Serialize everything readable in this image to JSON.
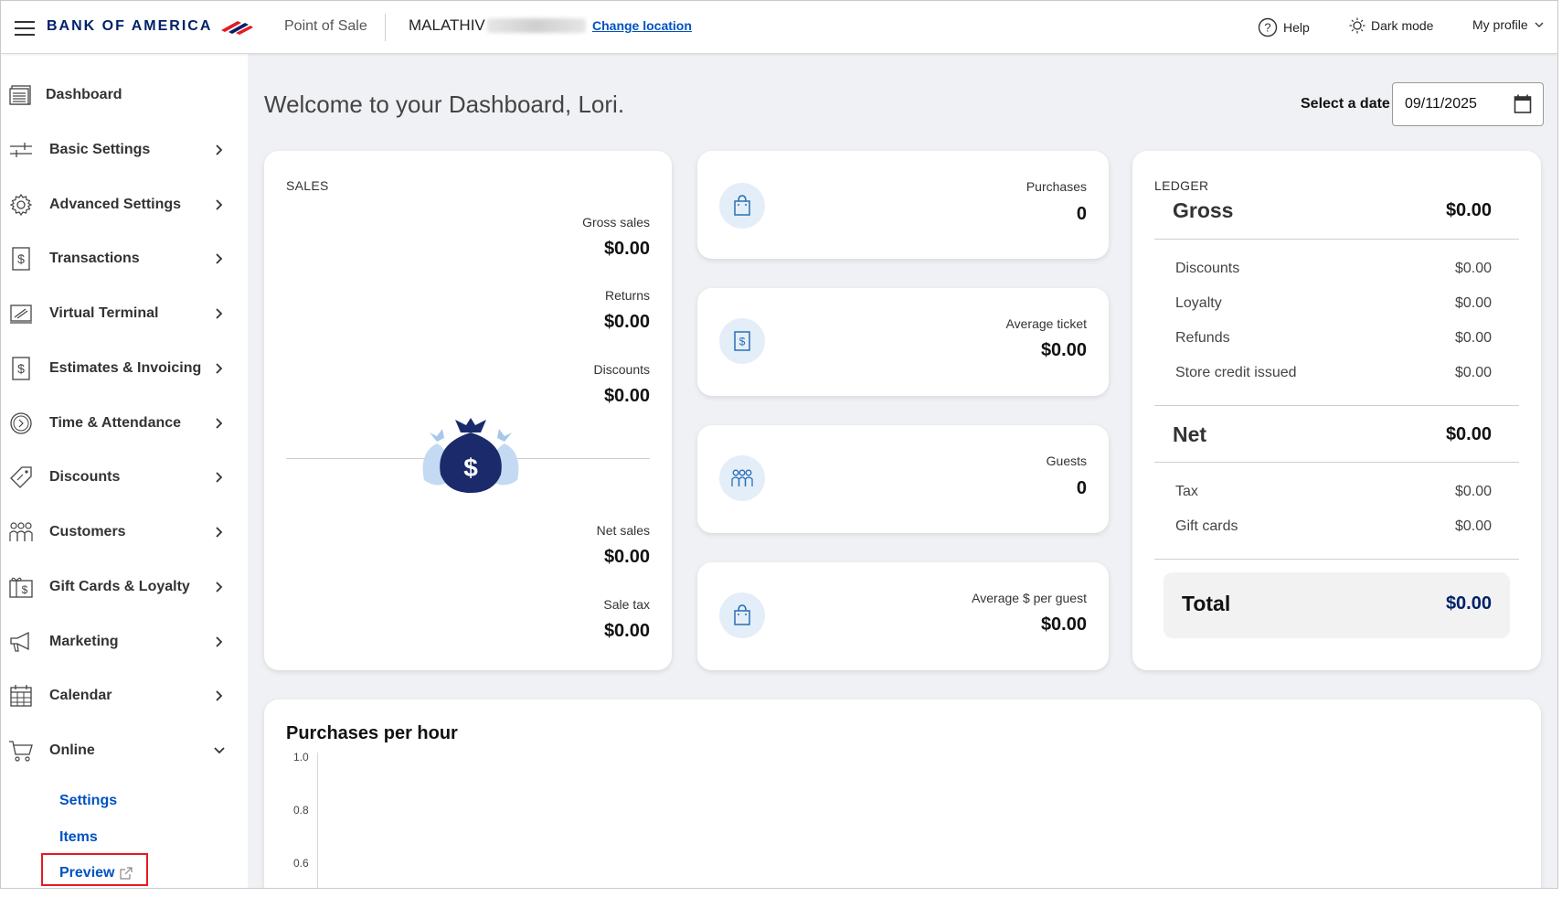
{
  "header": {
    "logo_text": "BANK OF AMERICA",
    "product": "Point of Sale",
    "merchant_name": "MALATHIV",
    "change_location": "Change location",
    "help": "Help",
    "dark_mode": "Dark mode",
    "my_profile": "My profile"
  },
  "sidebar": {
    "items": [
      {
        "label": "Dashboard",
        "icon": "dashboard-icon"
      },
      {
        "label": "Basic Settings",
        "icon": "sliders-icon"
      },
      {
        "label": "Advanced Settings",
        "icon": "gear-icon"
      },
      {
        "label": "Transactions",
        "icon": "dollar-document-icon"
      },
      {
        "label": "Virtual Terminal",
        "icon": "terminal-icon"
      },
      {
        "label": "Estimates & Invoicing",
        "icon": "invoice-icon"
      },
      {
        "label": "Time & Attendance",
        "icon": "clock-icon"
      },
      {
        "label": "Discounts",
        "icon": "tag-icon"
      },
      {
        "label": "Customers",
        "icon": "people-icon"
      },
      {
        "label": "Gift Cards & Loyalty",
        "icon": "gift-card-icon"
      },
      {
        "label": "Marketing",
        "icon": "megaphone-icon"
      },
      {
        "label": "Calendar",
        "icon": "calendar-icon"
      },
      {
        "label": "Online",
        "icon": "cart-icon"
      }
    ],
    "online_sub": {
      "settings": "Settings",
      "items": "Items",
      "preview": "Preview"
    }
  },
  "main": {
    "welcome": "Welcome to your Dashboard, Lori.",
    "date_label": "Select a date",
    "date_value": "09/11/2025"
  },
  "sales": {
    "title": "SALES",
    "gross_sales_label": "Gross sales",
    "gross_sales": "$0.00",
    "returns_label": "Returns",
    "returns": "$0.00",
    "discounts_label": "Discounts",
    "discounts": "$0.00",
    "net_sales_label": "Net sales",
    "net_sales": "$0.00",
    "sale_tax_label": "Sale tax",
    "sale_tax": "$0.00"
  },
  "metrics": [
    {
      "label": "Purchases",
      "value": "0",
      "icon": "shopping-bag-icon"
    },
    {
      "label": "Average ticket",
      "value": "$0.00",
      "icon": "receipt-icon"
    },
    {
      "label": "Guests",
      "value": "0",
      "icon": "guests-icon"
    },
    {
      "label": "Average $ per guest",
      "value": "$0.00",
      "icon": "shopping-bag-icon"
    }
  ],
  "ledger": {
    "title": "LEDGER",
    "gross_label": "Gross",
    "gross": "$0.00",
    "discounts_label": "Discounts",
    "discounts": "$0.00",
    "loyalty_label": "Loyalty",
    "loyalty": "$0.00",
    "refunds_label": "Refunds",
    "refunds": "$0.00",
    "store_credit_label": "Store credit issued",
    "store_credit": "$0.00",
    "net_label": "Net",
    "net": "$0.00",
    "tax_label": "Tax",
    "tax": "$0.00",
    "gift_cards_label": "Gift cards",
    "gift_cards": "$0.00",
    "total_label": "Total",
    "total": "$0.00"
  },
  "chart": {
    "title": "Purchases per hour",
    "y_ticks": [
      "1.0",
      "0.8",
      "0.6"
    ]
  },
  "colors": {
    "brand_navy": "#012169",
    "brand_red": "#e31b23",
    "link_blue": "#0052c2",
    "icon_bg": "#e4eef8"
  }
}
